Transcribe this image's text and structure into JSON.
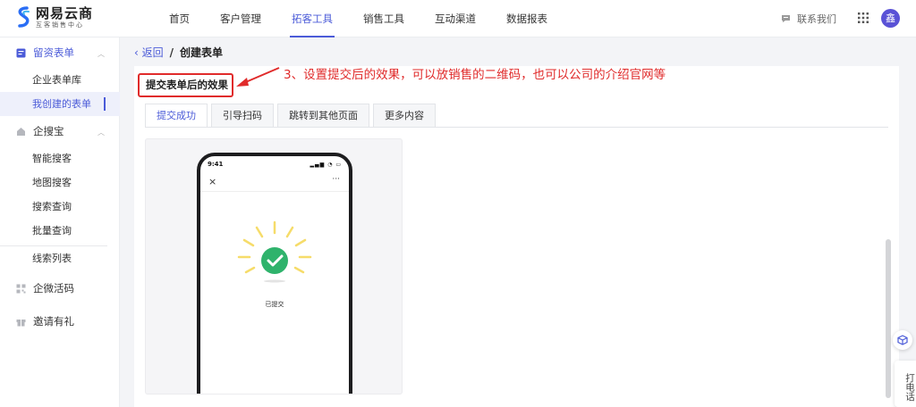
{
  "brand": {
    "name": "网易云商",
    "subtitle": "互客销售中心"
  },
  "nav": {
    "items": [
      "首页",
      "客户管理",
      "拓客工具",
      "销售工具",
      "互动渠道",
      "数据报表"
    ],
    "active_index": 2,
    "contact_label": "联系我们",
    "avatar_text": "鑫"
  },
  "sidebar": {
    "group_form": "留资表单",
    "form_items": [
      "企业表单库",
      "我创建的表单"
    ],
    "group_search": "企搜宝",
    "search_items": [
      "智能搜客",
      "地图搜客",
      "搜索查询",
      "批量查询"
    ],
    "leads": "线索列表",
    "wecom": "企微活码",
    "invite": "邀请有礼"
  },
  "breadcrumb": {
    "back": "返回",
    "separator": "/",
    "current": "创建表单"
  },
  "section_title": "提交表单后的效果",
  "annotation": "3、设置提交后的效果，可以放销售的二维码，也可以公司的介绍官网等",
  "tabs": [
    "提交成功",
    "引导扫码",
    "跳转到其他页面",
    "更多内容"
  ],
  "phone": {
    "time": "9:41",
    "close": "×",
    "more": "···",
    "status_text": "已提交"
  },
  "float_call": "打电话",
  "colors": {
    "accent": "#4b5bd8",
    "annotation_red": "#e02b2b",
    "success_green": "#2fb36c",
    "burst_yellow": "#f6dc6a"
  }
}
